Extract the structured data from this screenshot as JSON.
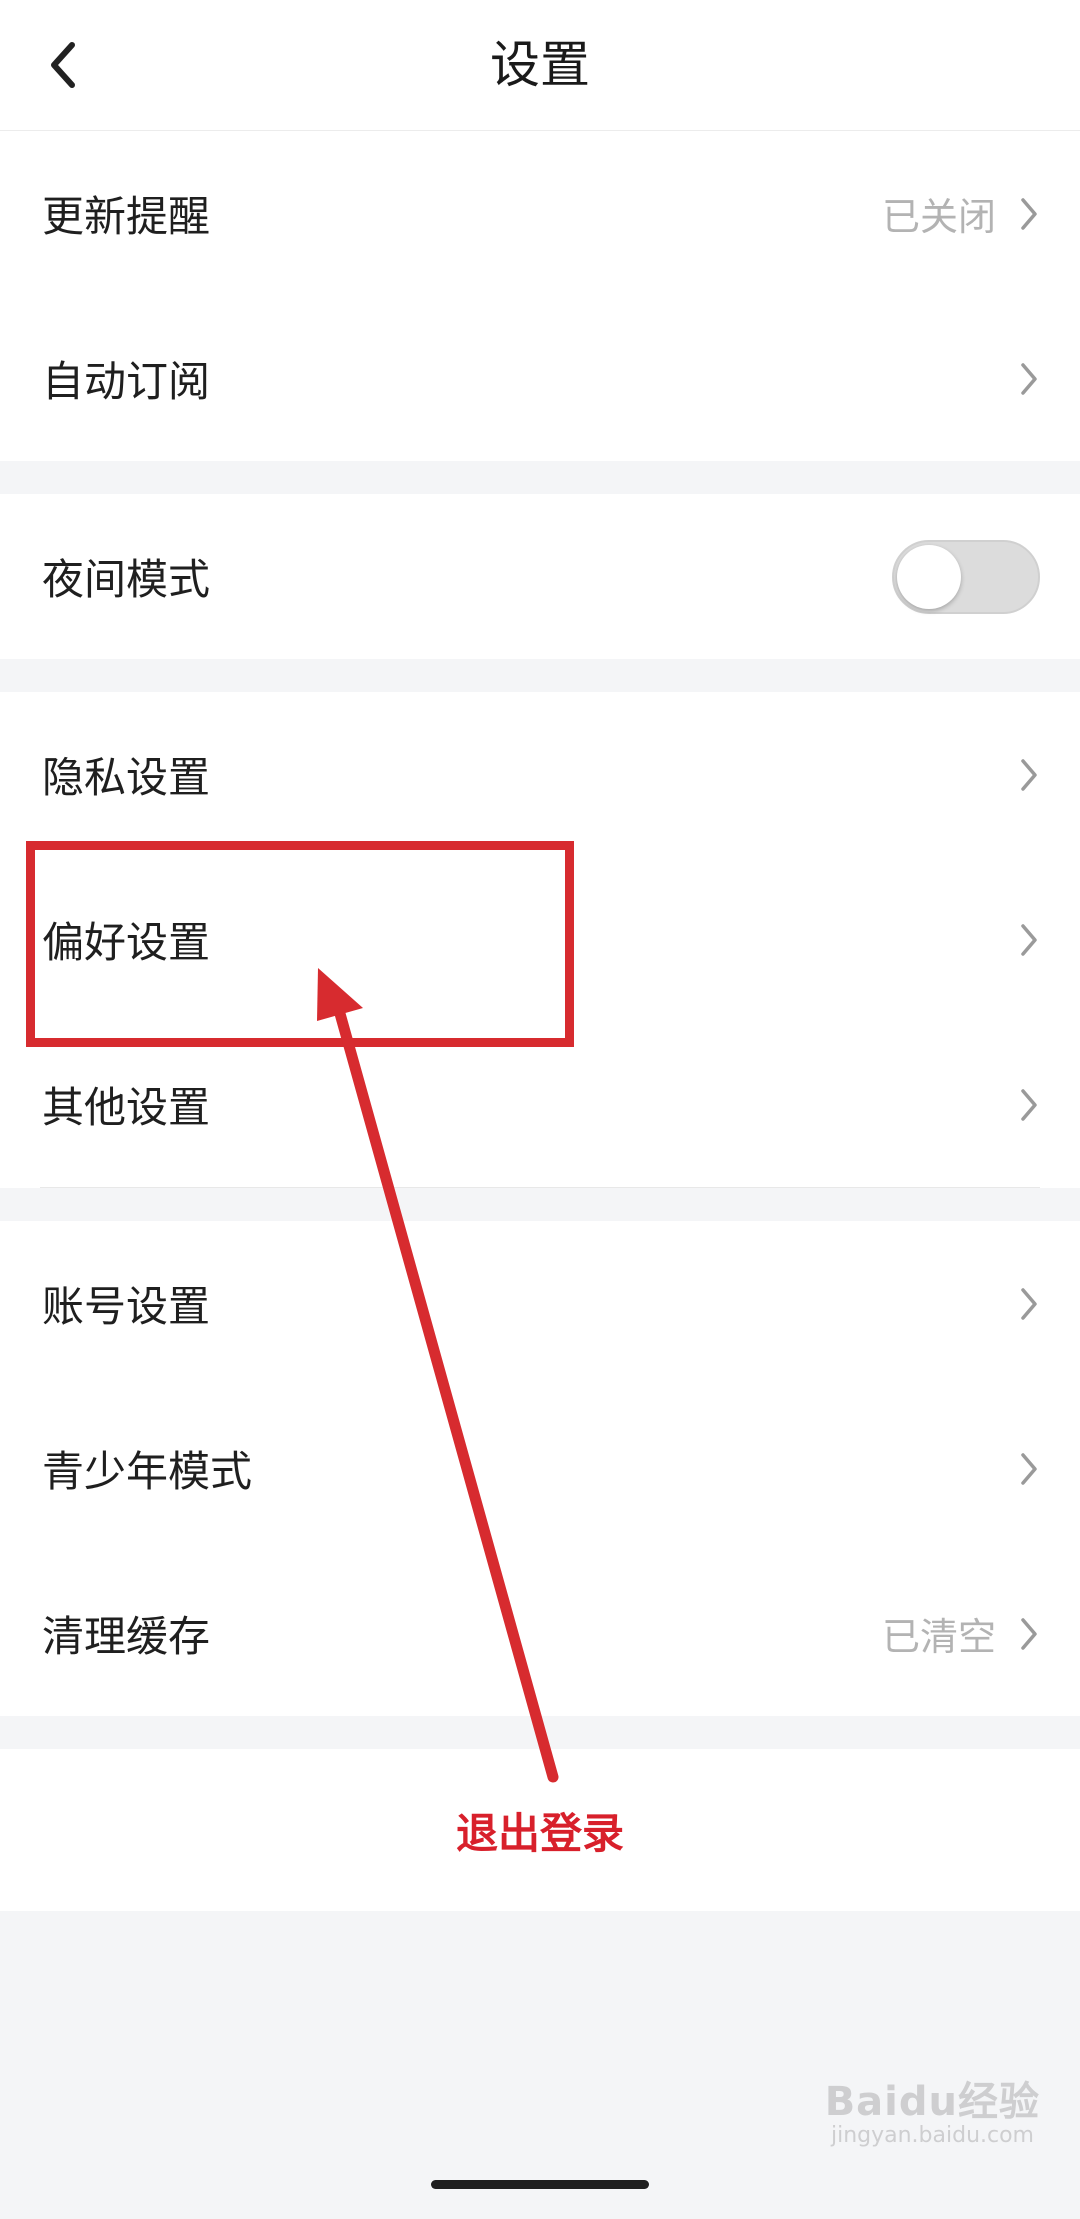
{
  "nav": {
    "title": "设置",
    "back_icon": "chevron-left-icon"
  },
  "groups": [
    {
      "rows": [
        {
          "label": "更新提醒",
          "value": "已关闭",
          "type": "link"
        },
        {
          "label": "自动订阅",
          "value": "",
          "type": "link"
        }
      ]
    },
    {
      "rows": [
        {
          "label": "夜间模式",
          "type": "toggle",
          "toggle_on": false
        }
      ]
    },
    {
      "rows": [
        {
          "label": "隐私设置",
          "value": "",
          "type": "link"
        },
        {
          "label": "偏好设置",
          "value": "",
          "type": "link"
        },
        {
          "label": "其他设置",
          "value": "",
          "type": "link"
        }
      ]
    },
    {
      "rows": [
        {
          "label": "账号设置",
          "value": "",
          "type": "link"
        },
        {
          "label": "青少年模式",
          "value": "",
          "type": "link"
        },
        {
          "label": "清理缓存",
          "value": "已清空",
          "type": "link"
        }
      ]
    }
  ],
  "logout_label": "退出登录",
  "watermark": {
    "main": "Baidu经验",
    "sub": "jingyan.baidu.com"
  },
  "colors": {
    "accent_red": "#d8202b",
    "annotation_red": "#d72b2f",
    "background": "#f4f5f7",
    "toggle_off": "#dcdcdc"
  }
}
